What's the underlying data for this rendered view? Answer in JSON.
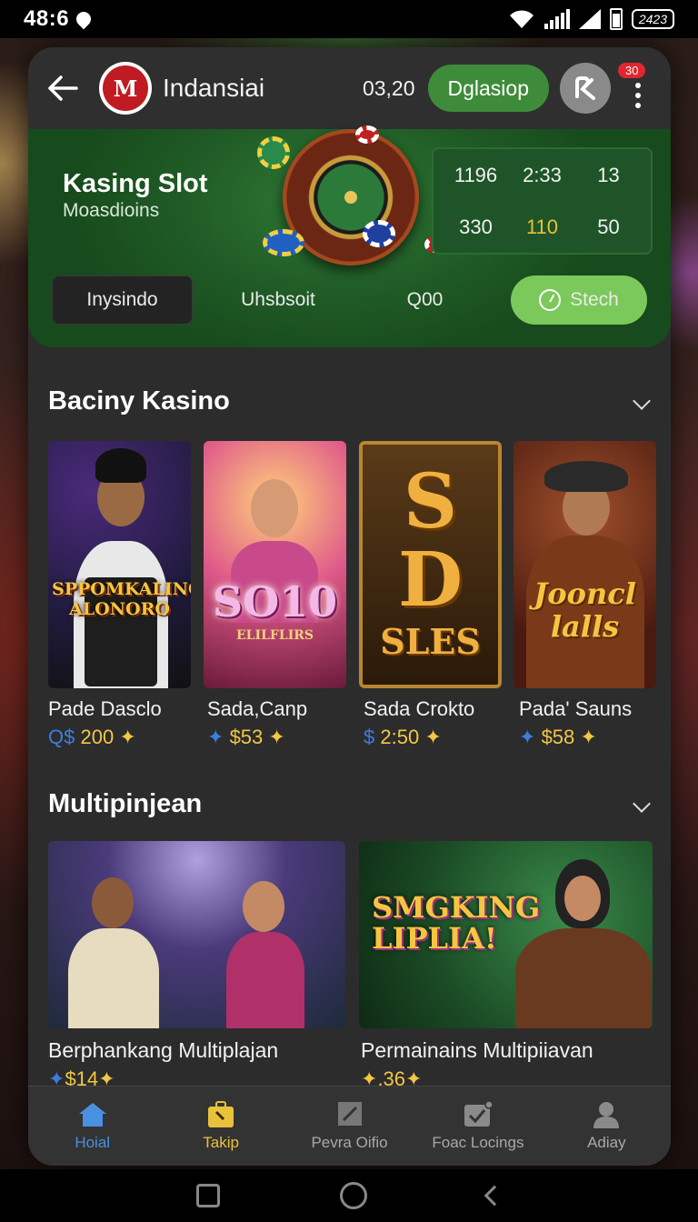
{
  "status_bar": {
    "time": "48:6",
    "battery_text": "2423"
  },
  "app_bar": {
    "brand": "Indansiai",
    "logo_text": "M",
    "balance": "03,20",
    "deposit_label": "Dglasiop",
    "notification_count": "30"
  },
  "hero": {
    "title": "Kasing Slot",
    "subtitle": "Moasdioins",
    "stats": [
      {
        "value": "1196",
        "highlight": false
      },
      {
        "value": "2:33",
        "highlight": false
      },
      {
        "value": "13",
        "highlight": false
      },
      {
        "value": "330",
        "highlight": false
      },
      {
        "value": "110",
        "highlight": true
      },
      {
        "value": "50",
        "highlight": false
      }
    ],
    "tabs": [
      "Inysindo",
      "Uhsbsoit",
      "Q00"
    ],
    "action_label": "Stech"
  },
  "section1": {
    "title": "Baciny Kasino",
    "cards": [
      {
        "name": "Pade Dasclo",
        "price_prefix": "Q$",
        "price": "200",
        "art_text": "SPPOMKALING ALONORO"
      },
      {
        "name": "Sada,Canp",
        "price_prefix": "✦",
        "price": "$53",
        "art_text": "SO10",
        "art_sub": "ELILFLIRS"
      },
      {
        "name": "Sada Crokto",
        "price_prefix": "$",
        "price": "2:50",
        "art_text": "SD",
        "art_sub": "SLES"
      },
      {
        "name": "Pada' Sauns",
        "price_prefix": "✦",
        "price": "$58",
        "art_text": "Jooncl lalls"
      }
    ]
  },
  "section2": {
    "title": "Multipinjean",
    "cards": [
      {
        "name": "Berphankang Multiplajan",
        "price_prefix": "✦",
        "price": "$14"
      },
      {
        "name": "Permainains Multipiiavan",
        "price_prefix": "✦",
        "price": ".36",
        "art_text": "SMGKING LIPLIA!"
      }
    ]
  },
  "nav": [
    {
      "label": "Hoial",
      "icon": "home-icon"
    },
    {
      "label": "Takip",
      "icon": "briefcase-icon"
    },
    {
      "label": "Pevra Oifio",
      "icon": "box-x-icon"
    },
    {
      "label": "Foac Locings",
      "icon": "check-box-icon"
    },
    {
      "label": "Adiay",
      "icon": "person-icon"
    }
  ],
  "colors": {
    "accent_green": "#3e8c3a",
    "action_green": "#7bc95a",
    "gold": "#f2c744",
    "nav_active": "#4a90e2"
  }
}
